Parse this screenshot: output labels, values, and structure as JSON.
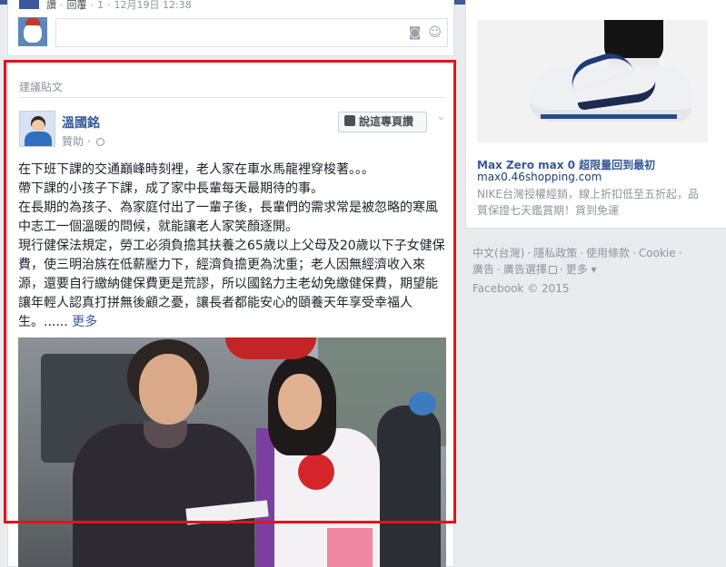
{
  "previous_post": {
    "meta_like": "讚",
    "meta_reply": "回覆",
    "meta_count": "1",
    "meta_time": "12月19日 12:38",
    "comment_icons": [
      "camera-icon",
      "emoji-icon"
    ]
  },
  "suggested": {
    "section_title": "建議貼文",
    "author_name": "溫國銘",
    "sponsored_label": "贊助",
    "like_page_label": "說這專頁讚",
    "body_lines": [
      "在下班下課的交通巔峰時刻裡，老人家在車水馬龍裡穿梭著。。。",
      "帶下課的小孩子下課，成了家中長輩每天最期待的事。",
      "在長期的為孩子、為家庭付出了一輩子後，長輩們的需求常是被忽略的寒風中志工一個溫暖的問候，就能讓老人家笑顏逐開。",
      "現行健保法規定，勞工必須負擔其扶養之65歲以上父母及20歲以下子女健保費，使三明治族在低薪壓力下，經濟負擔更為沈重；老人因無經濟收入來源，還要自行繳納健保費更是荒謬，所以國銘力主老幼免繳健保費，期望能讓年輕人認真打拼無後顧之憂，讓長者都能安心的頤養天年享受幸福人生。......"
    ],
    "see_more": "更多"
  },
  "ad": {
    "title": "Max Zero max 0 超限量回到最初",
    "domain": "max0.46shopping.com",
    "description": "NIKE台灣授權經銷，線上折扣低至五折起，品質保證七天鑑賞期！貨到免運"
  },
  "footer": {
    "links": [
      "中文(台灣)",
      "隱私政策",
      "使用條款",
      "Cookie",
      "廣告",
      "廣告選擇",
      "更多"
    ],
    "copyright": "Facebook © 2015"
  }
}
